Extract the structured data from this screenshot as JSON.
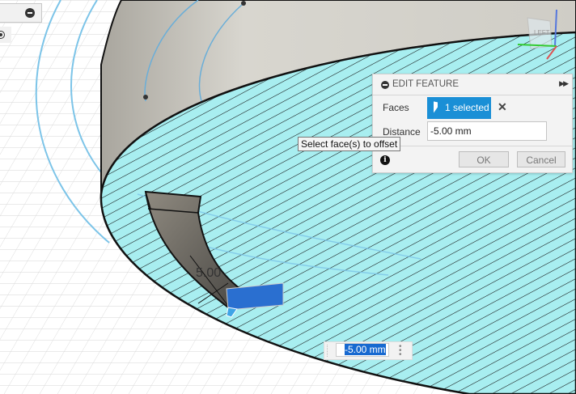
{
  "dialog": {
    "title": "EDIT FEATURE",
    "faces_label": "Faces",
    "faces_value": "1 selected",
    "distance_label": "Distance",
    "distance_value": "-5.00 mm",
    "ok_label": "OK",
    "cancel_label": "Cancel",
    "info_icon": "i"
  },
  "tooltip": "Select face(s) to offset",
  "viewport": {
    "dimension_label": "5.00",
    "inline_distance": "-5.00 mm",
    "viewcube_face": "LEFT",
    "hatch_color": "#a8eef0",
    "selection_color": "#2a6fd0"
  }
}
